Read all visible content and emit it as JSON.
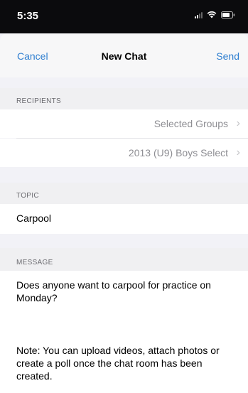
{
  "status_bar": {
    "time": "5:35",
    "icons": [
      "signal-icon",
      "wifi-icon",
      "battery-icon"
    ]
  },
  "nav": {
    "cancel_label": "Cancel",
    "title": "New Chat",
    "send_label": "Send",
    "accent_color": "#2f7fd0"
  },
  "recipients": {
    "header": "RECIPIENTS",
    "items": [
      {
        "label": "Selected Groups",
        "icon": "chevron-right-icon"
      },
      {
        "label": "2013 (U9) Boys Select",
        "icon": "chevron-right-icon"
      }
    ]
  },
  "topic": {
    "header": "TOPIC",
    "value": "Carpool"
  },
  "message": {
    "header": "MESSAGE",
    "value": "Does anyone want to carpool for practice on Monday?"
  },
  "note": {
    "text": "Note: You can upload videos, attach photos or create a poll once the chat room has been created."
  }
}
